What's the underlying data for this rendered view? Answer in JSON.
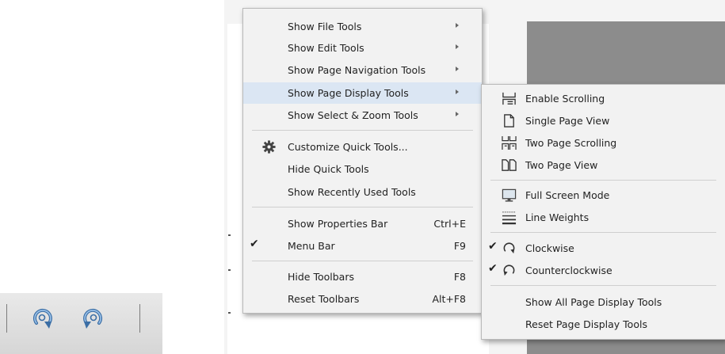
{
  "main_menu": {
    "items": [
      {
        "label": "Show File Tools",
        "submenu": true
      },
      {
        "label": "Show Edit Tools",
        "submenu": true
      },
      {
        "label": "Show Page Navigation Tools",
        "submenu": true
      },
      {
        "label": "Show Page Display Tools",
        "submenu": true,
        "highlighted": true
      },
      {
        "label": "Show Select & Zoom Tools",
        "submenu": true
      },
      {
        "label": "Customize Quick Tools...",
        "icon": "gear-icon"
      },
      {
        "label": "Hide Quick Tools"
      },
      {
        "label": "Show Recently Used Tools"
      },
      {
        "label": "Show Properties Bar",
        "shortcut": "Ctrl+E"
      },
      {
        "label": "Menu Bar",
        "shortcut": "F9",
        "checked": true
      },
      {
        "label": "Hide Toolbars",
        "shortcut": "F8"
      },
      {
        "label": "Reset Toolbars",
        "shortcut": "Alt+F8"
      }
    ],
    "check_mark": "✔"
  },
  "submenu": {
    "items": [
      {
        "label": "Enable Scrolling",
        "icon": "scrolling-icon"
      },
      {
        "label": "Single Page View",
        "icon": "single-page-icon"
      },
      {
        "label": "Two Page Scrolling",
        "icon": "two-page-scrolling-icon"
      },
      {
        "label": "Two Page View",
        "icon": "two-page-view-icon"
      },
      {
        "label": "Full Screen Mode",
        "icon": "monitor-icon"
      },
      {
        "label": "Line Weights",
        "icon": "line-weights-icon"
      },
      {
        "label": "Clockwise",
        "icon": "rotate-clockwise-icon",
        "checked": true
      },
      {
        "label": "Counterclockwise",
        "icon": "rotate-counterclockwise-icon",
        "checked": true
      },
      {
        "label": "Show All Page Display Tools"
      },
      {
        "label": "Reset Page Display Tools"
      }
    ],
    "check_mark": "✔"
  },
  "toolbar": {
    "buttons": [
      {
        "icon": "rotate-clockwise-icon"
      },
      {
        "icon": "rotate-counterclockwise-icon"
      }
    ]
  },
  "colors": {
    "menu_background": "#f2f2f2",
    "highlight": "#dbe6f3",
    "gray_pane": "#8c8c8c",
    "icon_blue": "#3b6ea5"
  }
}
